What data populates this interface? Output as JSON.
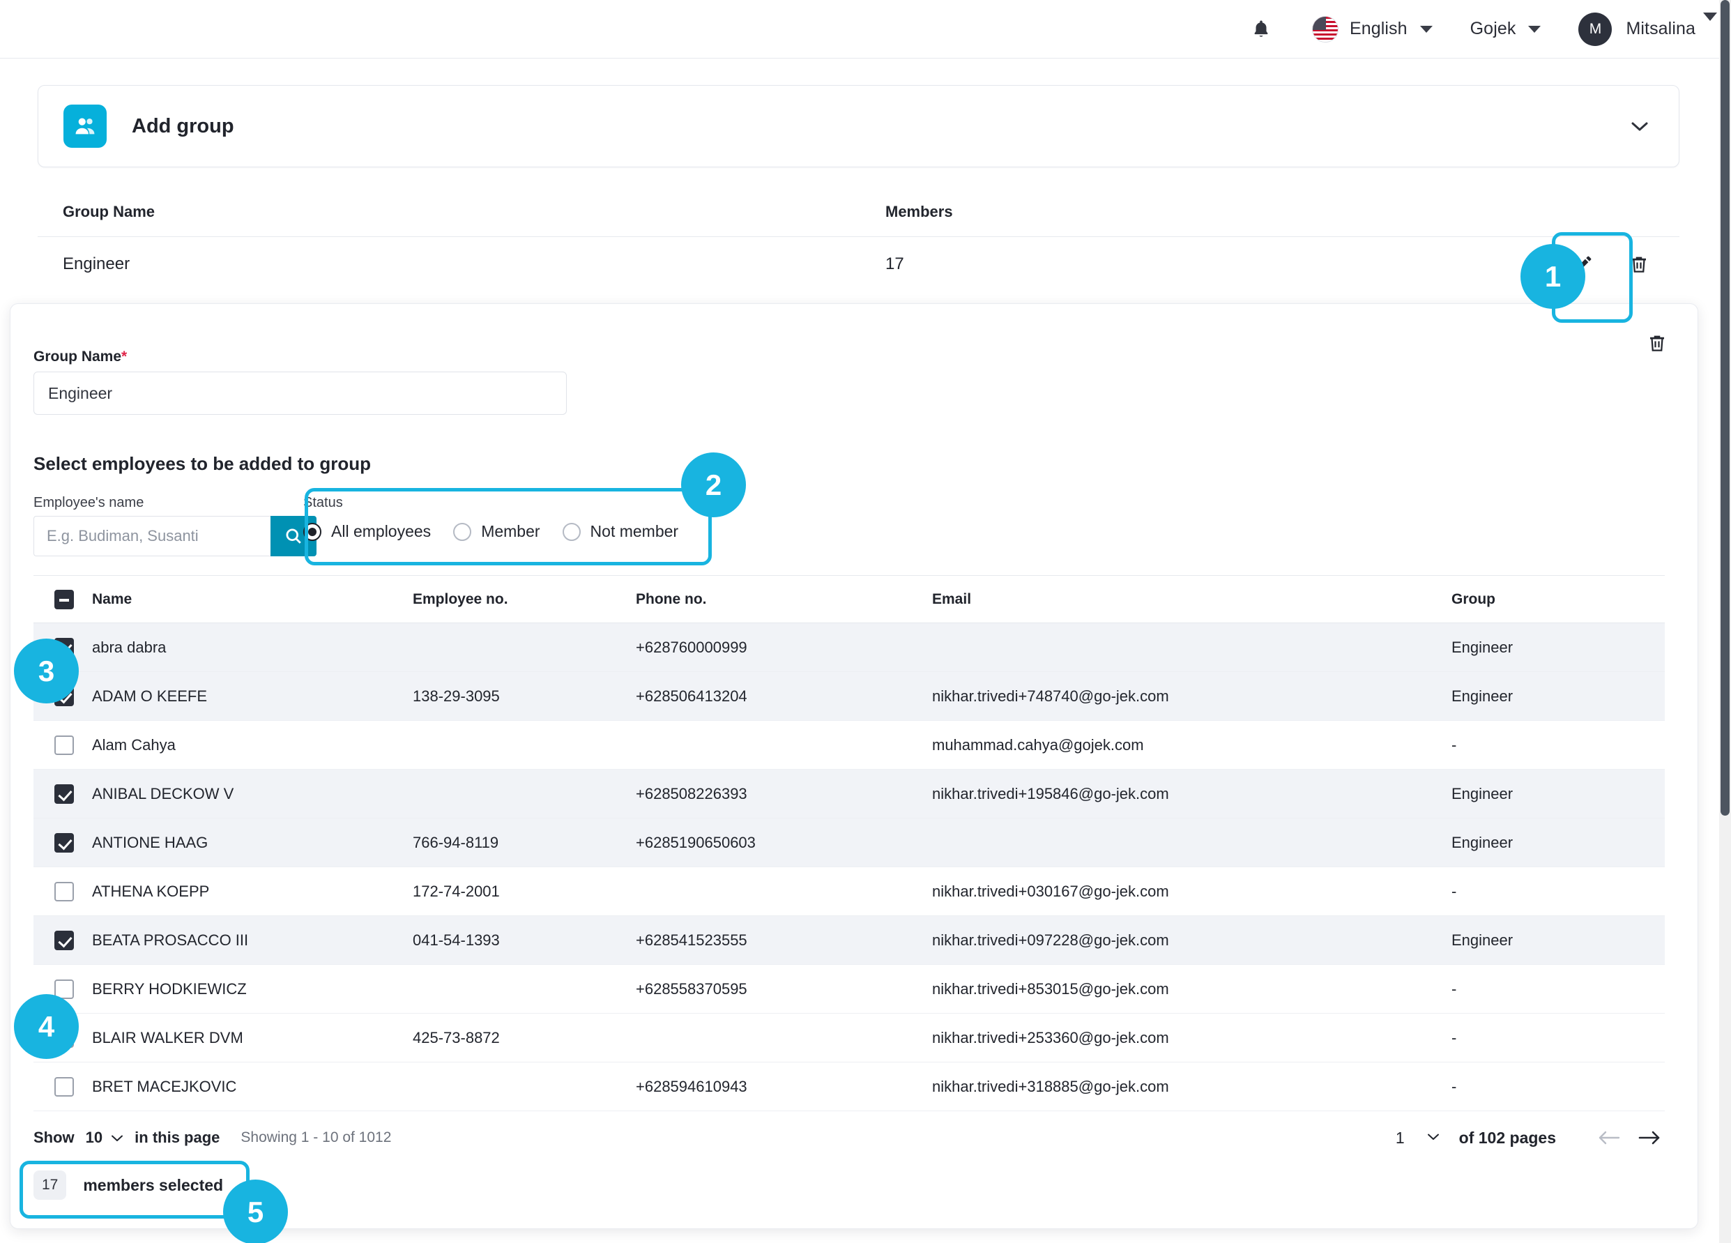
{
  "topbar": {
    "bell_icon": "bell-icon",
    "language": "English",
    "language_caret": "chevron-down-icon",
    "organization": "Gojek",
    "org_caret": "chevron-down-icon",
    "user_initial": "M",
    "user_name": "Mitsalina"
  },
  "add_group_card": {
    "icon": "users-icon",
    "title": "Add group",
    "chevron": "chevron-down-icon"
  },
  "group_table": {
    "headers": {
      "name": "Group Name",
      "members": "Members"
    },
    "row": {
      "name": "Engineer",
      "members": "17",
      "edit_icon": "pencil-icon",
      "delete_icon": "trash-icon"
    }
  },
  "panel": {
    "delete_icon": "trash-icon",
    "group_name_label": "Group Name",
    "required_mark": "*",
    "group_name_value": "Engineer",
    "section_title": "Select employees to be added to group",
    "search": {
      "label": "Employee's name",
      "placeholder": "E.g. Budiman, Susanti",
      "value": "",
      "button_icon": "search-icon"
    },
    "status": {
      "label": "Status",
      "options": [
        {
          "label": "All employees",
          "selected": true
        },
        {
          "label": "Member",
          "selected": false
        },
        {
          "label": "Not member",
          "selected": false
        }
      ]
    }
  },
  "employee_table": {
    "headers": {
      "select_all": "indeterminate",
      "name": "Name",
      "employee_no": "Employee no.",
      "phone_no": "Phone no.",
      "email": "Email",
      "group": "Group"
    },
    "rows": [
      {
        "checked": true,
        "name": "abra dabra",
        "employee_no": "",
        "phone_no": "+628760000999",
        "email": "",
        "group": "Engineer"
      },
      {
        "checked": true,
        "name": "ADAM O KEEFE",
        "employee_no": "138-29-3095",
        "phone_no": "+628506413204",
        "email": "nikhar.trivedi+748740@go-jek.com",
        "group": "Engineer"
      },
      {
        "checked": false,
        "name": "Alam Cahya",
        "employee_no": "",
        "phone_no": "",
        "email": "muhammad.cahya@gojek.com",
        "group": "-"
      },
      {
        "checked": true,
        "name": "ANIBAL DECKOW V",
        "employee_no": "",
        "phone_no": "+628508226393",
        "email": "nikhar.trivedi+195846@go-jek.com",
        "group": "Engineer"
      },
      {
        "checked": true,
        "name": "ANTIONE HAAG",
        "employee_no": "766-94-8119",
        "phone_no": "+6285190650603",
        "email": "",
        "group": "Engineer"
      },
      {
        "checked": false,
        "name": "ATHENA KOEPP",
        "employee_no": "172-74-2001",
        "phone_no": "",
        "email": "nikhar.trivedi+030167@go-jek.com",
        "group": "-"
      },
      {
        "checked": true,
        "name": "BEATA PROSACCO III",
        "employee_no": "041-54-1393",
        "phone_no": "+628541523555",
        "email": "nikhar.trivedi+097228@go-jek.com",
        "group": "Engineer"
      },
      {
        "checked": false,
        "name": "BERRY HODKIEWICZ",
        "employee_no": "",
        "phone_no": "+628558370595",
        "email": "nikhar.trivedi+853015@go-jek.com",
        "group": "-"
      },
      {
        "checked": false,
        "name": "BLAIR WALKER DVM",
        "employee_no": "425-73-8872",
        "phone_no": "",
        "email": "nikhar.trivedi+253360@go-jek.com",
        "group": "-"
      },
      {
        "checked": false,
        "name": "BRET MACEJKOVIC",
        "employee_no": "",
        "phone_no": "+628594610943",
        "email": "nikhar.trivedi+318885@go-jek.com",
        "group": "-"
      }
    ]
  },
  "footer": {
    "show_label": "Show",
    "page_size": "10",
    "in_this_page": "in this page",
    "showing_text": "Showing 1 - 10 of 1012",
    "current_page": "1",
    "of_pages": "of 102 pages",
    "prev_icon": "arrow-left-icon",
    "next_icon": "arrow-right-icon",
    "members_selected_count": "17",
    "members_selected_label": "members selected"
  },
  "callouts": [
    {
      "number": "1"
    },
    {
      "number": "2"
    },
    {
      "number": "3"
    },
    {
      "number": "4"
    },
    {
      "number": "5"
    }
  ],
  "colors": {
    "accent": "#18b4e0",
    "brand": "#06b0db",
    "search_button": "#0091b3",
    "required": "#e0274b",
    "row_alt": "#f1f3f7"
  }
}
